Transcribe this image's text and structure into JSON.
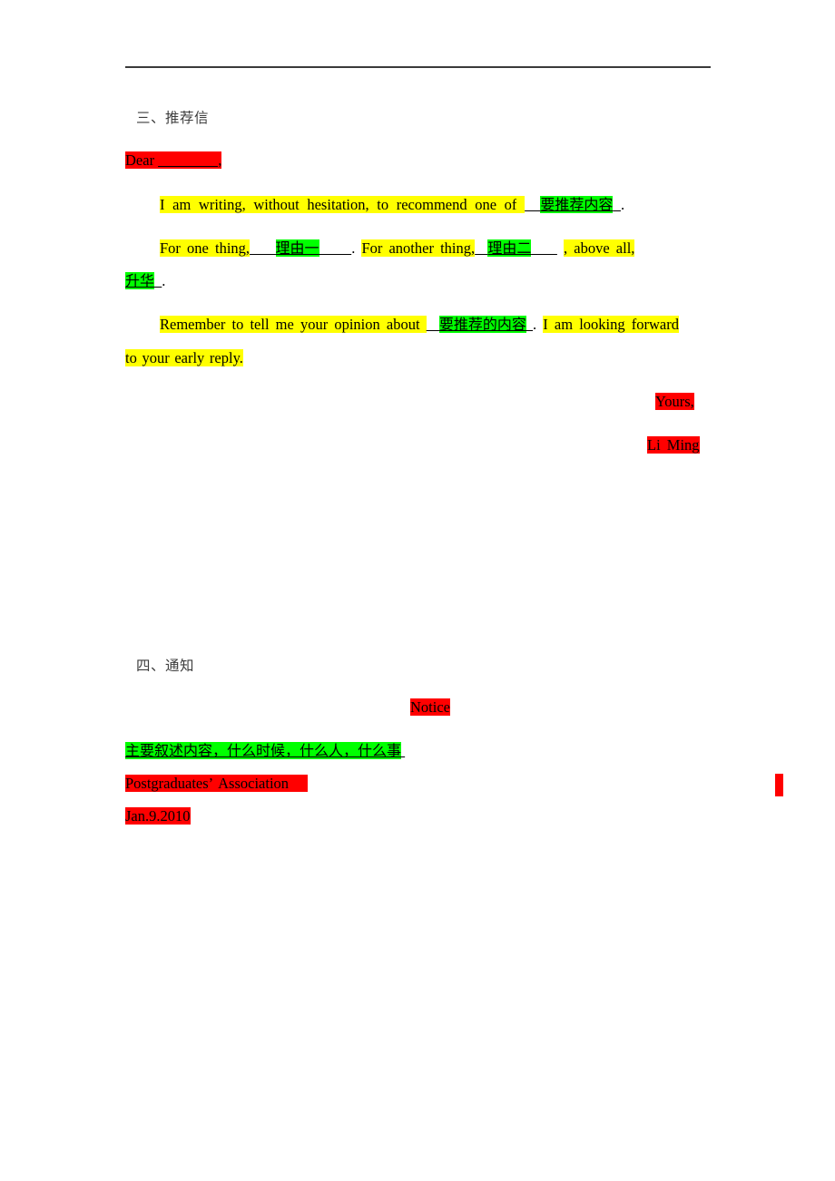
{
  "document": {
    "type": "chinese-english-letter-template-worksheet",
    "page_background": "#ffffff",
    "text_color": "#000000",
    "colors": {
      "highlight_yellow": "#ffff00",
      "highlight_green": "#00ff00",
      "highlight_red": "#ff0000",
      "rule": "#3a3a3a",
      "heading_text": "#3d3d3d"
    }
  },
  "section_recommendation": {
    "heading": "三、推荐信",
    "salutation": {
      "word": "Dear",
      "blank": "________",
      "comma": ","
    },
    "para1": {
      "text_before": "I am writing, without hesitation, to recommend one of",
      "placeholder": "要推荐内容",
      "period": "."
    },
    "para2": {
      "seg1": "For one thing,",
      "placeholder1": "理由一",
      "period1": ".",
      "seg2": "For another thing,",
      "placeholder2": "理由二",
      "seg3": ", above all,",
      "placeholder3": "升华",
      "period2": "."
    },
    "para3": {
      "text_before": "Remember to tell me your opinion about",
      "placeholder": "要推荐的内容",
      "period": ".",
      "text_after_line1": "I am looking forward",
      "text_after_line2": "to your early reply."
    },
    "closing": "Yours,",
    "signature": "Li Ming"
  },
  "section_notice": {
    "heading": "四、通知",
    "title": "Notice",
    "body_placeholder": "主要叙述内容，什么时候，什么人，什么事",
    "signer": "Postgraduates’ Association",
    "date": "Jan.9.2010"
  }
}
